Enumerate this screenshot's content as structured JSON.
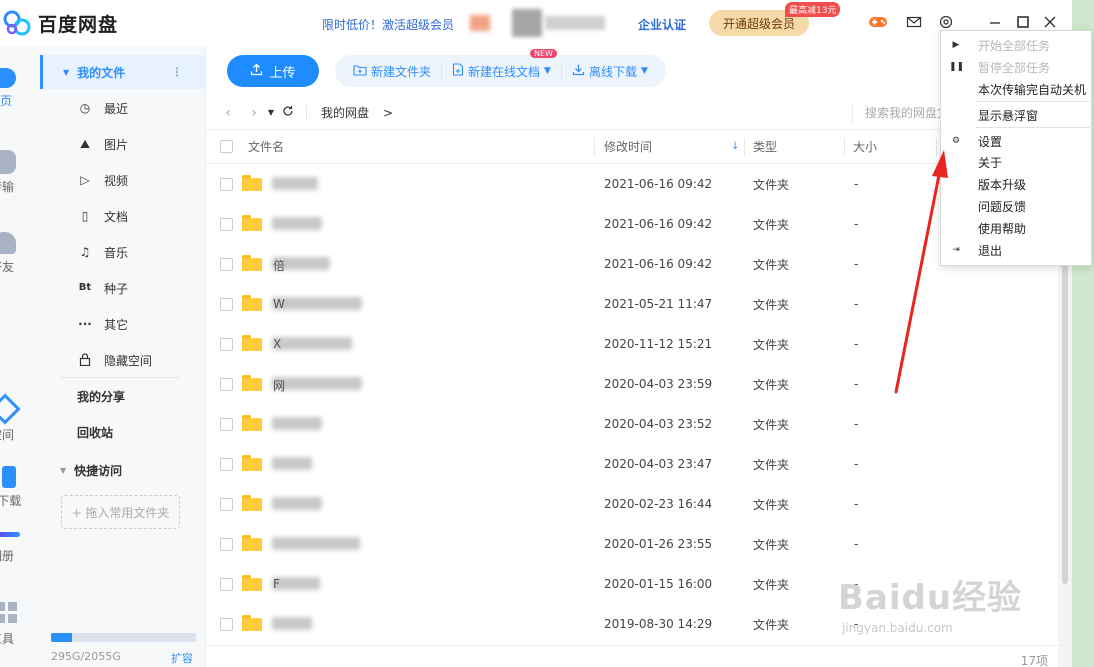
{
  "app": {
    "name": "百度网盘",
    "promo_text": "限时低价！激活超级会员",
    "enterprise_label": "企业认证",
    "vip_button": "开通超级会员",
    "vip_badge": "最高减13元"
  },
  "rail": {
    "items": [
      {
        "label": "首页",
        "active": true
      },
      {
        "label": "传输"
      },
      {
        "label": "好友"
      },
      {
        "label": "空间"
      },
      {
        "label": "P下载"
      },
      {
        "label": "相册"
      },
      {
        "label": "工具"
      }
    ]
  },
  "sidebar": {
    "my_files": "我的文件",
    "items": [
      {
        "label": "最近",
        "icon": "clock-icon",
        "glyph": "◷"
      },
      {
        "label": "图片",
        "icon": "mountain-icon",
        "glyph": "⛰"
      },
      {
        "label": "视频",
        "icon": "play-icon",
        "glyph": "▷"
      },
      {
        "label": "文档",
        "icon": "document-icon",
        "glyph": "▯"
      },
      {
        "label": "音乐",
        "icon": "headphones-icon",
        "glyph": "♫"
      },
      {
        "label": "种子",
        "icon": "bt-icon",
        "glyph": "Bt"
      },
      {
        "label": "其它",
        "icon": "more-icon",
        "glyph": "···"
      },
      {
        "label": "隐藏空间",
        "icon": "lock-icon",
        "glyph": "🔒"
      }
    ],
    "my_share": "我的分享",
    "recycle_bin": "回收站",
    "quick_access": "快捷访问",
    "drop_hint": "+ 拖入常用文件夹",
    "storage_text": "295G/2055G",
    "storage_used_fraction": 0.1435,
    "expand_label": "扩容"
  },
  "toolbar": {
    "upload": "上传",
    "new_folder": "新建文件夹",
    "new_online_doc": "新建在线文档",
    "new_badge": "NEW",
    "offline_download": "离线下载"
  },
  "nav": {
    "breadcrumb_root": "我的网盘",
    "breadcrumb_sep": ">",
    "search_placeholder": "搜索我的网盘文件"
  },
  "table": {
    "columns": {
      "name": "文件名",
      "modified": "修改时间",
      "type": "类型",
      "size": "大小"
    },
    "rows": [
      {
        "name_prefix": "",
        "modified": "2021-06-16 09:42",
        "type": "文件夹",
        "size": "-"
      },
      {
        "name_prefix": "",
        "modified": "2021-06-16 09:42",
        "type": "文件夹",
        "size": "-"
      },
      {
        "name_prefix": "倍",
        "modified": "2021-06-16 09:42",
        "type": "文件夹",
        "size": "-"
      },
      {
        "name_prefix": "W",
        "modified": "2021-05-21 11:47",
        "type": "文件夹",
        "size": "-"
      },
      {
        "name_prefix": "X",
        "modified": "2020-11-12 15:21",
        "type": "文件夹",
        "size": "-"
      },
      {
        "name_prefix": "网",
        "modified": "2020-04-03 23:59",
        "type": "文件夹",
        "size": "-"
      },
      {
        "name_prefix": "",
        "modified": "2020-04-03 23:52",
        "type": "文件夹",
        "size": "-"
      },
      {
        "name_prefix": "",
        "modified": "2020-04-03 23:47",
        "type": "文件夹",
        "size": "-"
      },
      {
        "name_prefix": "",
        "modified": "2020-02-23 16:44",
        "type": "文件夹",
        "size": "-"
      },
      {
        "name_prefix": "",
        "modified": "2020-01-26 23:55",
        "type": "文件夹",
        "size": "-"
      },
      {
        "name_prefix": "F",
        "modified": "2020-01-15 16:00",
        "type": "文件夹",
        "size": "-"
      },
      {
        "name_prefix": "",
        "modified": "2019-08-30 14:29",
        "type": "文件夹",
        "size": "-"
      }
    ],
    "item_count": "17项"
  },
  "menu": {
    "items": [
      {
        "label": "开始全部任务",
        "disabled": true,
        "icon": "play-icon",
        "glyph": "▶"
      },
      {
        "label": "暂停全部任务",
        "disabled": true,
        "icon": "pause-icon",
        "glyph": "❚❚"
      },
      {
        "label": "本次传输完自动关机",
        "disabled": false
      },
      {
        "label": "显示悬浮窗",
        "disabled": false
      },
      {
        "label": "设置",
        "disabled": false,
        "icon": "gear-icon",
        "glyph": "⚙"
      },
      {
        "label": "关于",
        "disabled": false
      },
      {
        "label": "版本升级",
        "disabled": false
      },
      {
        "label": "问题反馈",
        "disabled": false
      },
      {
        "label": "使用帮助",
        "disabled": false
      },
      {
        "label": "退出",
        "disabled": false,
        "icon": "exit-icon",
        "glyph": "⇥"
      }
    ]
  },
  "watermark": {
    "main": "Baidu经验",
    "sub": "jingyan.baidu.com"
  },
  "colors": {
    "accent": "#2c8fff",
    "folder": "#ffcd3c",
    "annotation": "#e8251f"
  }
}
